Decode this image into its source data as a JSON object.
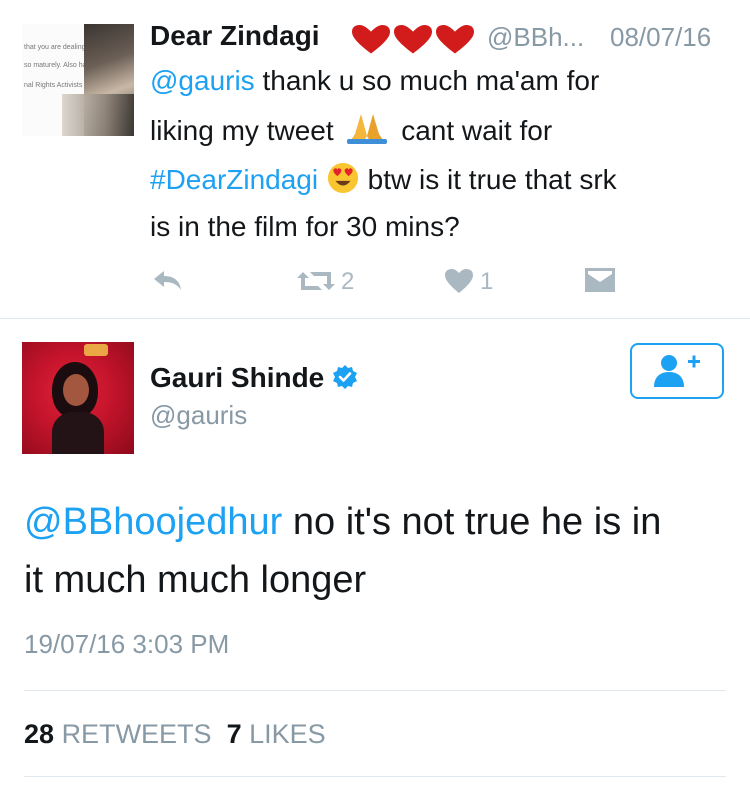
{
  "quoted_tweet": {
    "display_name": "Dear Zindagi",
    "name_emoji": [
      "heart-emoji",
      "heart-emoji",
      "heart-emoji"
    ],
    "handle": "@BBh...",
    "date": "08/07/16",
    "avatar_text": [
      "that you are dealing with",
      "so maturely. Also have a",
      "nal Rights Activists may"
    ],
    "line1_mention": "@gauris",
    "line1_rest": " thank u so much ma'am for",
    "line2_text": "liking my tweet",
    "line2_emoji": "folded-hands-emoji",
    "line2_rest": "cant wait for",
    "line3_hashtag": "#DearZindagi",
    "line3_emoji": "heart-eyes-emoji",
    "line3_rest": "btw is it true that srk",
    "line4": "is in the film for 30 mins?",
    "retweet_count": "2",
    "like_count": "1"
  },
  "main_tweet": {
    "display_name": "Gauri Shinde",
    "verified": true,
    "handle": "@gauris",
    "mention": "@BBhoojedhur",
    "line1_rest": " no it's not true he is in",
    "line2": "it much much longer",
    "timestamp": "19/07/16 3:03 PM",
    "retweets_count": "28",
    "retweets_label": "RETWEETS",
    "likes_count": "7",
    "likes_label": "LIKES"
  },
  "colors": {
    "link": "#1da1f2",
    "secondary_text": "#8899a6",
    "action_icon": "#aab8c2"
  }
}
